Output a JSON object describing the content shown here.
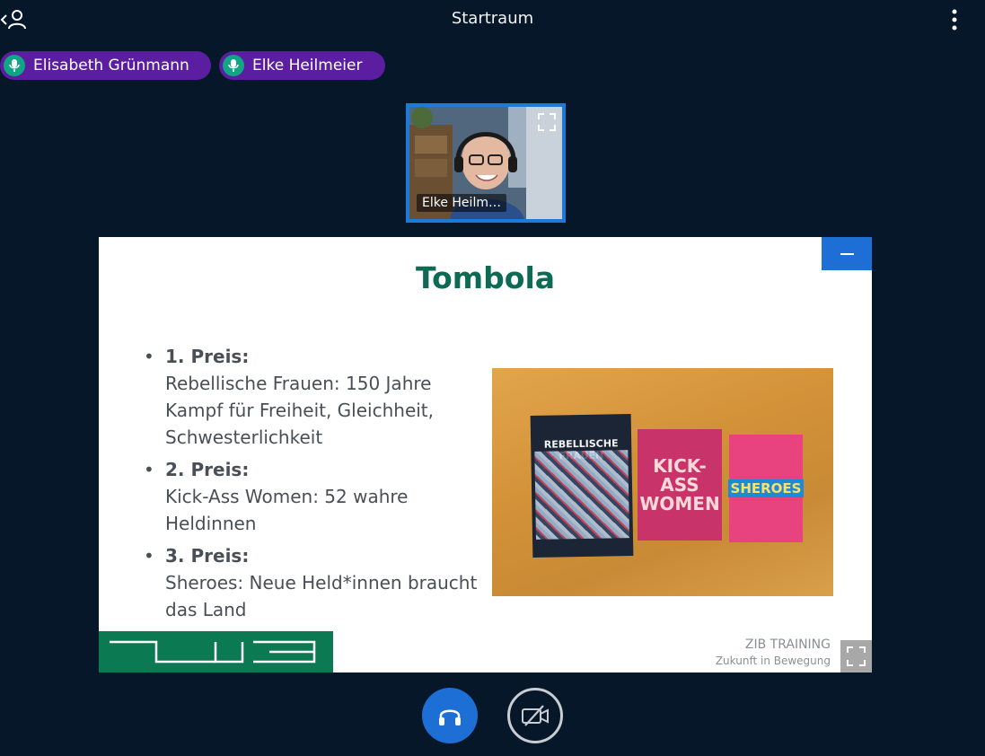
{
  "topbar": {
    "title": "Startraum",
    "back_icon": "chevron-left-icon",
    "user_icon": "user-icon",
    "menu_icon": "more-vertical-icon"
  },
  "talkers": [
    {
      "name": "Elisabeth Grünmann",
      "icon": "microphone-icon"
    },
    {
      "name": "Elke Heilmeier",
      "icon": "microphone-icon"
    }
  ],
  "webcam": {
    "label": "Elke Heilm…",
    "expand_icon": "fullscreen-icon"
  },
  "slide": {
    "title": "Tombola",
    "prizes": [
      {
        "rank": "1. Preis:",
        "desc": "Rebellische Frauen: 150 Jahre Kampf für Freiheit, Gleichheit, Schwesterlichkeit"
      },
      {
        "rank": "2. Preis:",
        "desc": "Kick-Ass Women: 52 wahre Heldinnen"
      },
      {
        "rank": "3. Preis:",
        "desc": "Sheroes: Neue Held*innen braucht das Land"
      }
    ],
    "books": [
      {
        "title": "REBELLISCHE FRAUEN"
      },
      {
        "title": "KICK-ASS WOMEN"
      },
      {
        "title": "SHEROES"
      }
    ],
    "footer_brand": "ZIB TRAINING",
    "footer_tagline": "Zukunft in Bewegung",
    "minimize_icon": "minus-icon",
    "expand_icon": "fullscreen-icon"
  },
  "controls": {
    "audio_icon": "headphones-icon",
    "video_icon": "video-off-icon"
  },
  "colors": {
    "background": "#06172a",
    "talker_pill": "#5b1ea0",
    "mic_active": "#10a585",
    "accent_blue": "#1d6fd6",
    "slide_title": "#0d6a55",
    "slide_footer": "#0b7a52"
  }
}
